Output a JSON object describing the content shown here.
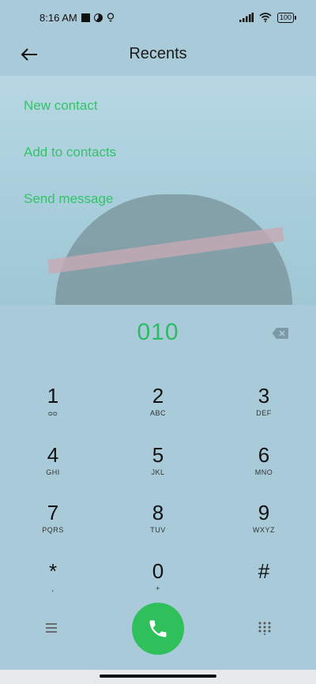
{
  "status_bar": {
    "time": "8:16 AM",
    "battery": "100"
  },
  "header": {
    "title": "Recents"
  },
  "menu": {
    "items": [
      {
        "label": "New contact"
      },
      {
        "label": "Add to contacts"
      },
      {
        "label": "Send message"
      }
    ]
  },
  "dialer": {
    "number": "010",
    "keys": [
      {
        "digit": "1",
        "letters": "ᴑᴑ"
      },
      {
        "digit": "2",
        "letters": "ABC"
      },
      {
        "digit": "3",
        "letters": "DEF"
      },
      {
        "digit": "4",
        "letters": "GHI"
      },
      {
        "digit": "5",
        "letters": "JKL"
      },
      {
        "digit": "6",
        "letters": "MNO"
      },
      {
        "digit": "7",
        "letters": "PQRS"
      },
      {
        "digit": "8",
        "letters": "TUV"
      },
      {
        "digit": "9",
        "letters": "WXYZ"
      },
      {
        "digit": "*",
        "letters": ","
      },
      {
        "digit": "0",
        "letters": "+"
      },
      {
        "digit": "#",
        "letters": ""
      }
    ]
  },
  "colors": {
    "accent_green": "#34c36b",
    "call_button": "#2fbf5b",
    "background": "#a9cad8"
  },
  "icons": {
    "back": "arrow-left-icon",
    "backspace": "backspace-icon",
    "call": "phone-icon",
    "menu": "menu-lines-icon",
    "dialpad": "dialpad-icon"
  }
}
